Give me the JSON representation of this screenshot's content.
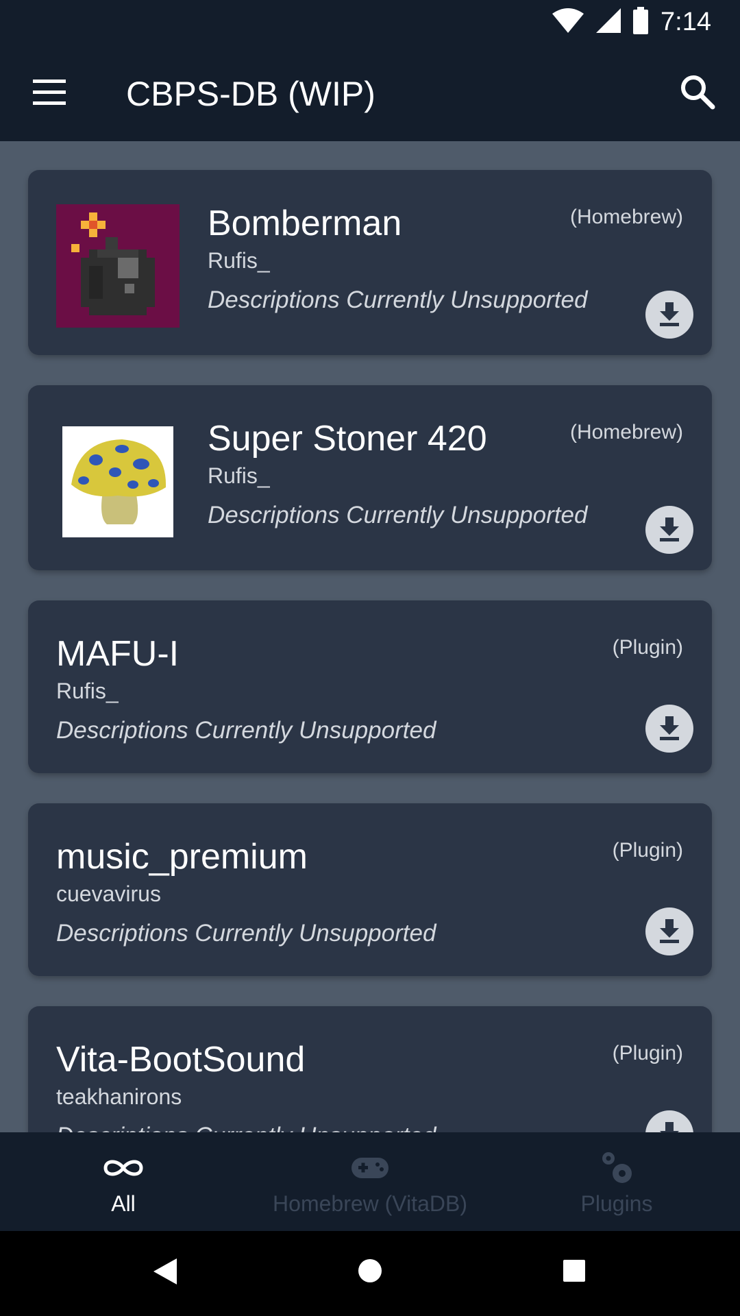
{
  "status_bar": {
    "time": "7:14",
    "icons": [
      "wifi-icon",
      "signal-icon",
      "battery-icon"
    ]
  },
  "app_bar": {
    "title": "CBPS-DB (WIP)",
    "menu_icon": "hamburger-menu-icon",
    "search_icon": "search-icon"
  },
  "items": [
    {
      "title": "Bomberman",
      "author": "Rufis_",
      "description": "Descriptions Currently Unsupported",
      "kind": "(Homebrew)",
      "has_thumb": true
    },
    {
      "title": "Super Stoner 420",
      "author": "Rufis_",
      "description": "Descriptions Currently Unsupported",
      "kind": "(Homebrew)",
      "has_thumb": true
    },
    {
      "title": "MAFU-I",
      "author": "Rufis_",
      "description": "Descriptions Currently Unsupported",
      "kind": "(Plugin)",
      "has_thumb": false
    },
    {
      "title": "music_premium",
      "author": "cuevavirus",
      "description": "Descriptions Currently Unsupported",
      "kind": "(Plugin)",
      "has_thumb": false
    },
    {
      "title": "Vita-BootSound",
      "author": "teakhanirons",
      "description": "Descriptions Currently Unsupported",
      "kind": "(Plugin)",
      "has_thumb": false
    }
  ],
  "bottom_nav": {
    "tabs": [
      {
        "label": "All",
        "icon": "infinity-icon",
        "active": true
      },
      {
        "label": "Homebrew (VitaDB)",
        "icon": "gamepad-icon",
        "active": false
      },
      {
        "label": "Plugins",
        "icon": "gears-icon",
        "active": false
      }
    ]
  },
  "colors": {
    "app_bar": "#131d2b",
    "background": "#4f5b6a",
    "card": "#2b3546",
    "inactive_tab": "#3a4658"
  }
}
